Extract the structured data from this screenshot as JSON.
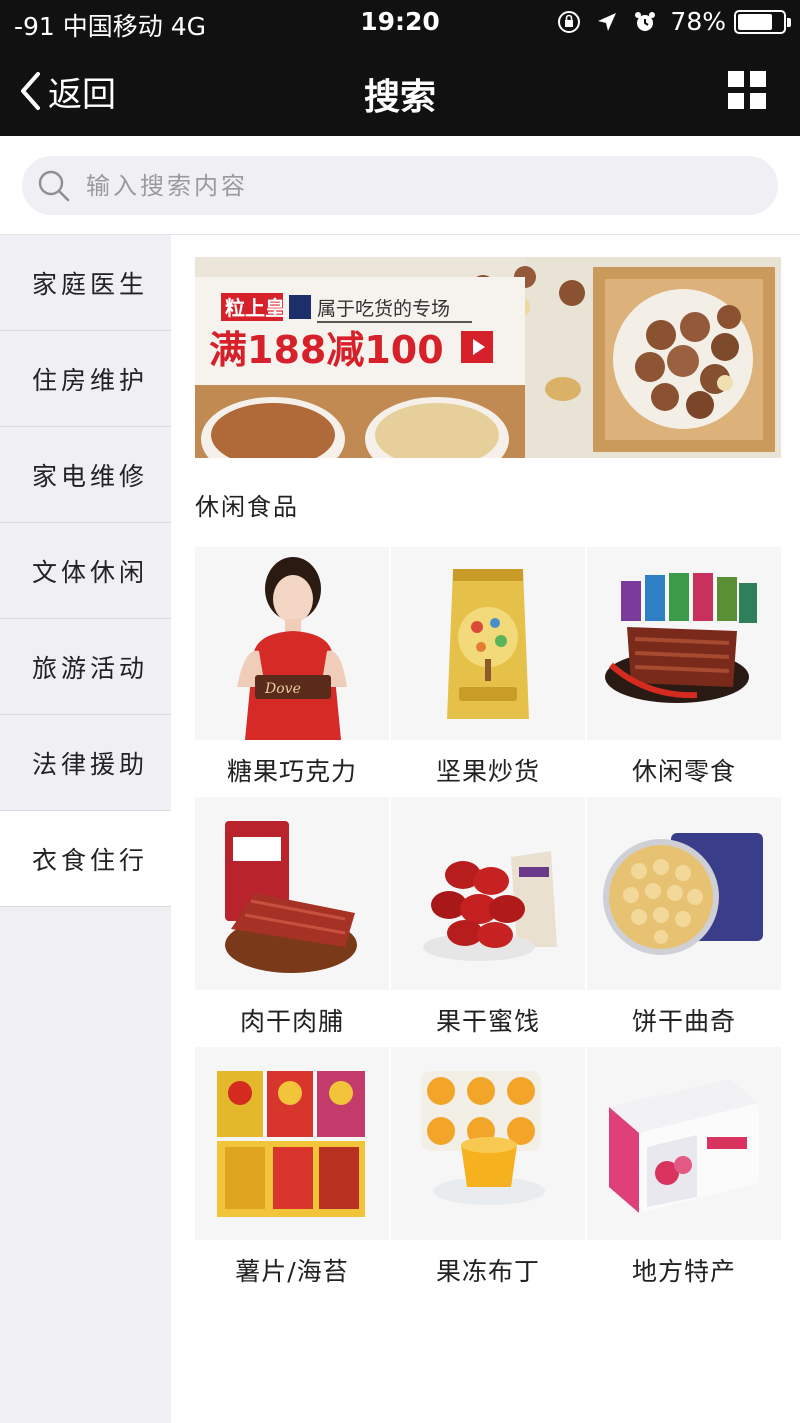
{
  "status_bar": {
    "carrier": "-91 中国移动  4G",
    "time": "19:20",
    "battery": "78%",
    "battery_level": 0.78
  },
  "nav": {
    "back_label": "返回",
    "title": "搜索"
  },
  "search": {
    "placeholder": "输入搜索内容"
  },
  "sidebar": {
    "items": [
      {
        "label": "家庭医生"
      },
      {
        "label": "住房维护"
      },
      {
        "label": "家电维修"
      },
      {
        "label": "文体休闲"
      },
      {
        "label": "旅游活动"
      },
      {
        "label": "法律援助"
      },
      {
        "label": "衣食住行"
      }
    ],
    "active_index": 6
  },
  "banner": {
    "brand": "粒上皇",
    "tagline": "属于吃货的专场",
    "promo": "满188减100"
  },
  "section": {
    "title": "休闲食品"
  },
  "categories": [
    {
      "label": "糖果巧克力",
      "icon": "chocolate-model-image"
    },
    {
      "label": "坚果炒货",
      "icon": "nut-bag-image"
    },
    {
      "label": "休闲零食",
      "icon": "jerky-snack-image"
    },
    {
      "label": "肉干肉脯",
      "icon": "meat-jerky-image"
    },
    {
      "label": "果干蜜饯",
      "icon": "red-dates-image"
    },
    {
      "label": "饼干曲奇",
      "icon": "cookie-tin-image"
    },
    {
      "label": "薯片/海苔",
      "icon": "chips-image"
    },
    {
      "label": "果冻布丁",
      "icon": "jelly-pudding-image"
    },
    {
      "label": "地方特产",
      "icon": "gift-box-image"
    }
  ],
  "colors": {
    "topbar": "#111111",
    "promo_red": "#d6202a",
    "sidebar_bg": "#efeff4"
  }
}
